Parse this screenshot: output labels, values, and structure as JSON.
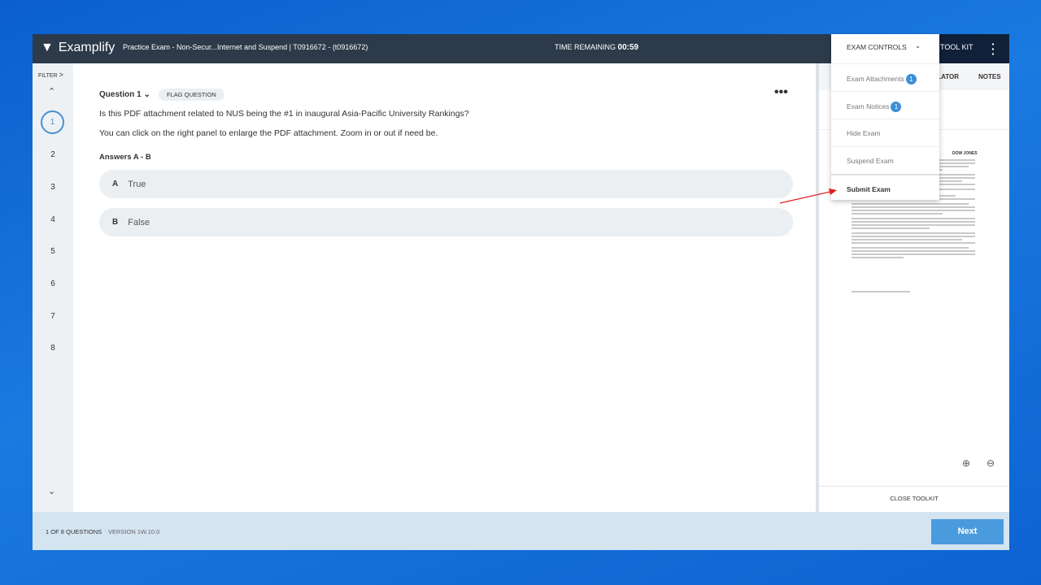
{
  "header": {
    "app_name": "Examplify",
    "exam_title": "Practice Exam - Non-Secur...Internet and Suspend | T0916672 - (t0916672)",
    "time_label": "TIME REMAINING",
    "time_value": "00:59",
    "toolkit_label": "TOOL KIT"
  },
  "nav": {
    "filter_label": "FILTER",
    "questions": [
      "1",
      "2",
      "3",
      "4",
      "5",
      "6",
      "7",
      "8"
    ],
    "current": "1"
  },
  "question": {
    "label": "Question 1",
    "flag_label": "FLAG QUESTION",
    "text": "Is this PDF attachment related to NUS being the #1 in inaugural Asia-Pacific University Rankings?",
    "instruction": "You can click on the right panel to enlarge the PDF attachment. Zoom in or out if need be.",
    "answers_label": "Answers A - B",
    "options": [
      {
        "letter": "A",
        "text": "True"
      },
      {
        "letter": "B",
        "text": "False"
      }
    ]
  },
  "toolkit": {
    "tabs": [
      "ILATOR",
      "NOTES"
    ],
    "pdf_header": "DOW JONES",
    "close_label": "CLOSE TOOLKIT"
  },
  "menu": {
    "title": "EXAM CONTROLS",
    "items": [
      {
        "label": "Exam Attachments",
        "badge": "1"
      },
      {
        "label": "Exam Notices",
        "badge": "1"
      },
      {
        "label": "Hide Exam"
      },
      {
        "label": "Suspend Exam"
      },
      {
        "label": "Submit Exam"
      }
    ]
  },
  "footer": {
    "progress": "1 OF 8 QUESTIONS",
    "version": "VERSION 1W.10.0",
    "next_label": "Next"
  },
  "colors": {
    "header": "#2c3a4a",
    "accent": "#4a9bdd",
    "annotation_arrow": "#e02020"
  }
}
